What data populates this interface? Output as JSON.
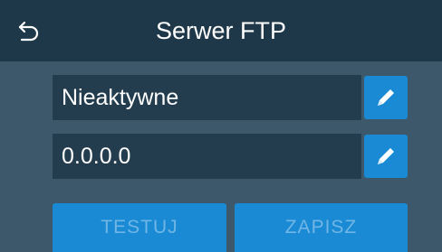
{
  "header": {
    "title": "Serwer FTP",
    "back_icon": "back-arrow-icon"
  },
  "fields": {
    "status": {
      "value": "Nieaktywne",
      "edit_icon": "pencil-icon"
    },
    "address": {
      "value": "0.0.0.0",
      "edit_icon": "pencil-icon"
    }
  },
  "buttons": {
    "test_label": "TESTUJ",
    "save_label": "ZAPISZ"
  },
  "colors": {
    "header_bg": "#1e3849",
    "body_bg": "#3d586b",
    "field_bg": "#233d4f",
    "accent": "#1a8ad4",
    "disabled_text": "#6fb6e6"
  }
}
